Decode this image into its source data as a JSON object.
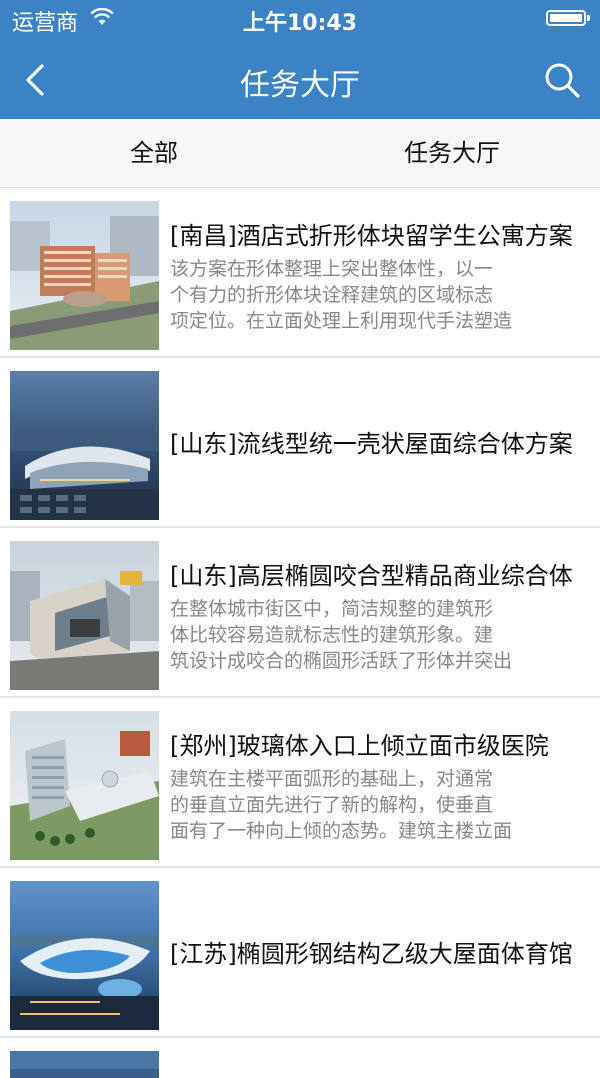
{
  "status_bar": {
    "carrier": "运营商",
    "time": "上午10:43"
  },
  "nav": {
    "title": "任务大厅",
    "back_icon": "chevron-left-icon",
    "search_icon": "search-icon"
  },
  "tabs": [
    {
      "label": "全部"
    },
    {
      "label": "任务大厅"
    }
  ],
  "colors": {
    "nav_blue": "#3b83c4",
    "desc_gray": "#888888"
  },
  "items": [
    {
      "title": "[南昌]酒店式折形体块留学生公寓方案",
      "desc": [
        "该方案在形体整理上突出整体性，以一",
        "个有力的折形体块诠释建筑的区域标志",
        "项定位。在立面处理上利用现代手法塑造"
      ]
    },
    {
      "title": "[山东]流线型统一壳状屋面综合体方案",
      "desc": []
    },
    {
      "title": "[山东]高层椭圆咬合型精品商业综合体",
      "desc": [
        "在整体城市街区中，简洁规整的建筑形",
        "体比较容易造就标志性的建筑形象。建",
        "筑设计成咬合的椭圆形活跃了形体并突出"
      ]
    },
    {
      "title": "[郑州]玻璃体入口上倾立面市级医院",
      "desc": [
        "建筑在主楼平面弧形的基础上，对通常",
        "的垂直立面先进行了新的解构，使垂直",
        "面有了一种向上倾的态势。建筑主楼立面"
      ]
    },
    {
      "title": "[江苏]椭圆形钢结构乙级大屋面体育馆",
      "desc": []
    }
  ]
}
